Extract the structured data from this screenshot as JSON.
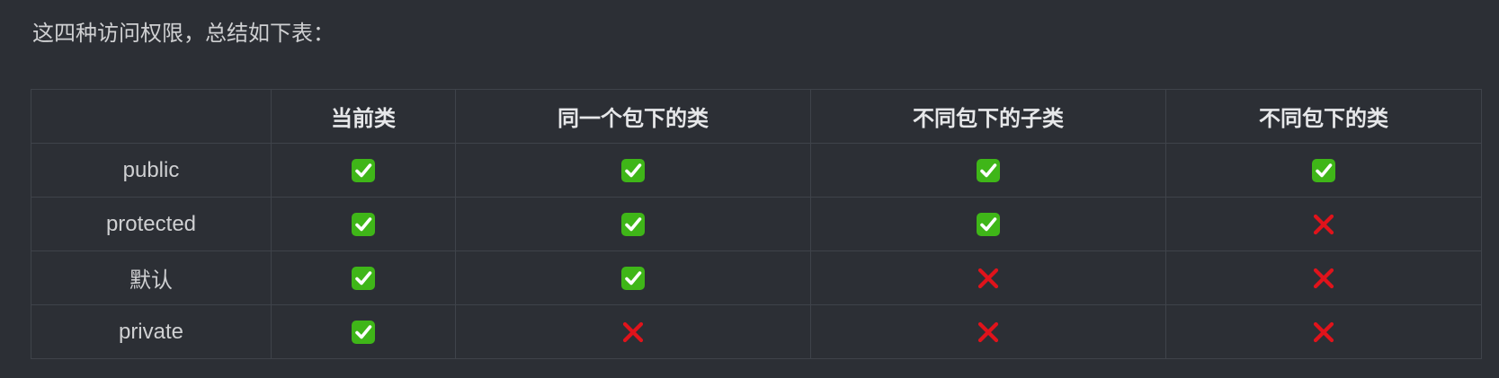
{
  "intro_text": "这四种访问权限，总结如下表：",
  "table": {
    "headers": [
      "",
      "当前类",
      "同一个包下的类",
      "不同包下的子类",
      "不同包下的类"
    ],
    "rows": [
      {
        "label": "public",
        "cells": [
          "check",
          "check",
          "check",
          "check"
        ]
      },
      {
        "label": "protected",
        "cells": [
          "check",
          "check",
          "check",
          "cross"
        ]
      },
      {
        "label": "默认",
        "cells": [
          "check",
          "check",
          "cross",
          "cross"
        ]
      },
      {
        "label": "private",
        "cells": [
          "check",
          "cross",
          "cross",
          "cross"
        ]
      }
    ]
  },
  "icons": {
    "check": "check-mark-button-icon",
    "cross": "cross-mark-icon"
  },
  "colors": {
    "background": "#2c2f35",
    "border": "#3f434a",
    "check_green": "#3fb618",
    "cross_red": "#e0131b"
  }
}
